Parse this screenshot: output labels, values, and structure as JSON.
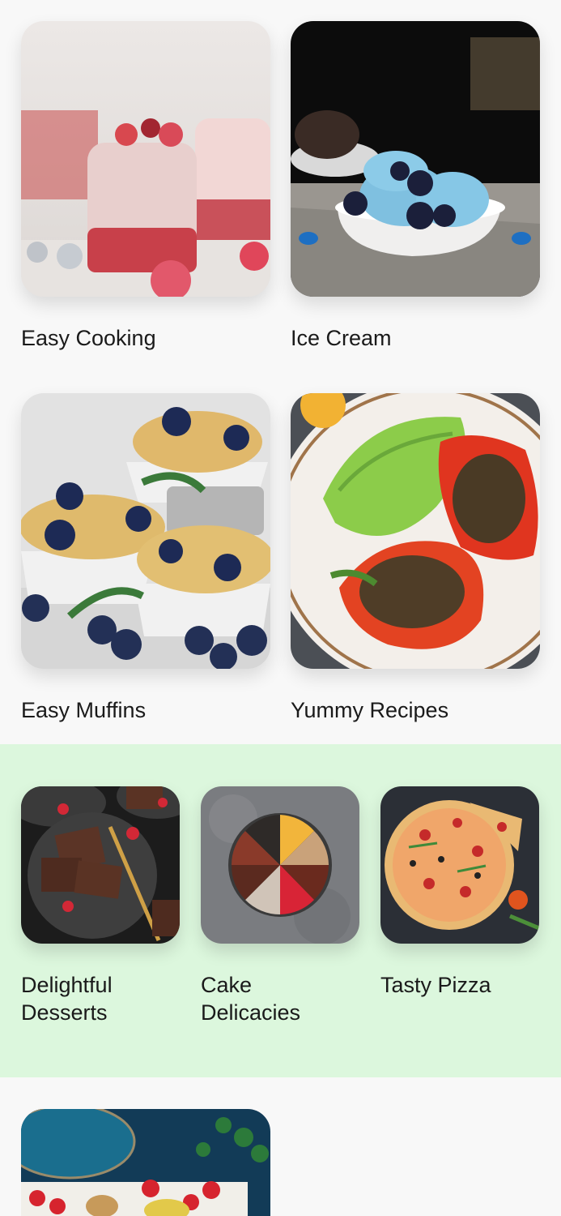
{
  "categories_top": [
    {
      "label": "Easy Cooking",
      "image": "dessert-jars-photo"
    },
    {
      "label": "Ice Cream",
      "image": "blue-ice-cream-photo"
    },
    {
      "label": "Easy Muffins",
      "image": "blueberry-muffins-photo"
    },
    {
      "label": "Yummy Recipes",
      "image": "stuffed-peppers-photo"
    }
  ],
  "featured_band": {
    "background": "#dcf7dd",
    "items": [
      {
        "label": "Delightful Desserts",
        "image": "brownies-photo"
      },
      {
        "label": "Cake Delicacies",
        "image": "cake-slices-photo"
      },
      {
        "label": "Tasty Pizza",
        "image": "pizza-photo"
      }
    ]
  },
  "categories_bottom": [
    {
      "label": "",
      "image": "fruit-platter-photo"
    }
  ]
}
